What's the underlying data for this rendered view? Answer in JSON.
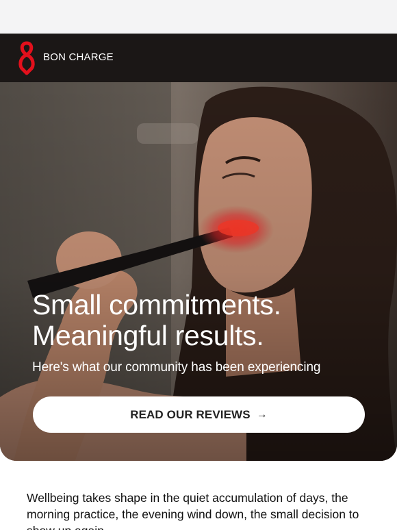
{
  "brand": {
    "name": "BON CHARGE",
    "logo_icon": "bon-charge-logo-icon",
    "accent_color": "#e3101c"
  },
  "hero": {
    "photo_icon": "woman-brushing-teeth-red-light-photo",
    "headline_line1": "Small commitments.",
    "headline_line2": "Meaningful results.",
    "subline": "Here's what our community has been experiencing",
    "cta_label": "READ OUR REVIEWS",
    "cta_arrow": "→"
  },
  "body": {
    "paragraph": "Wellbeing takes shape in the quiet accumulation of days, the morning practice, the evening wind down, the small decision to show up again."
  }
}
